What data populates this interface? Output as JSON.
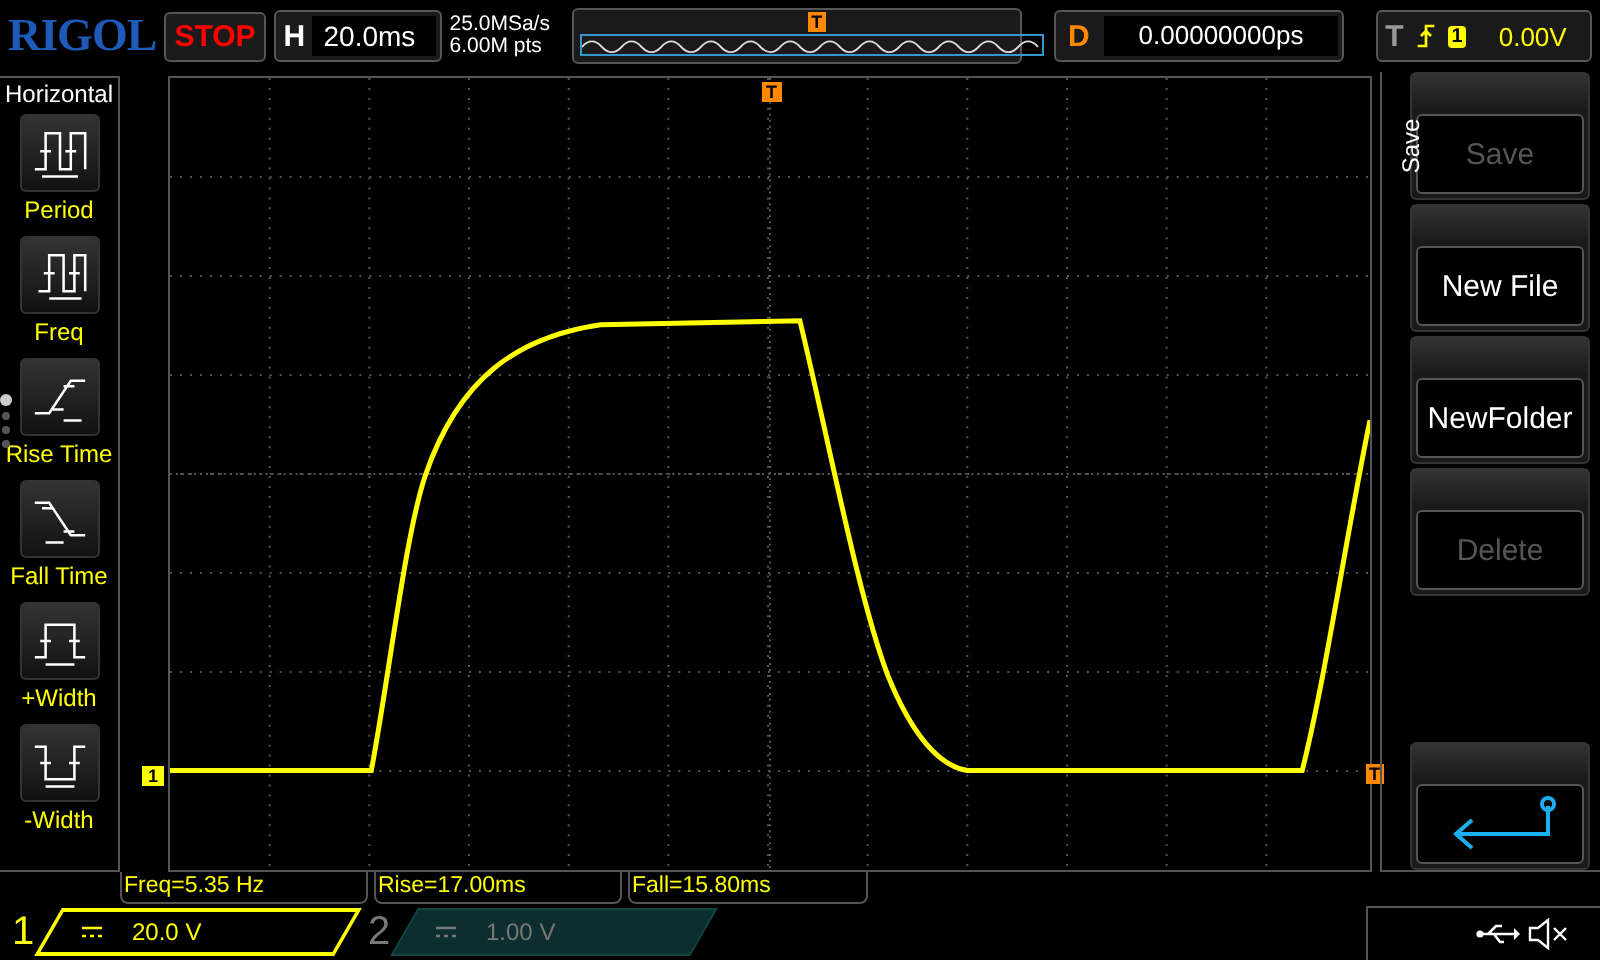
{
  "top_bar": {
    "logo": "RIGOL",
    "run_state": "STOP",
    "horizontal": {
      "label": "H",
      "value": "20.0ms"
    },
    "sample_rate": "25.0MSa/s",
    "memory_depth": "6.00M pts",
    "memory_trigger_marker": "T",
    "delay": {
      "label": "D",
      "value": "0.00000000ps"
    },
    "trigger": {
      "label": "T",
      "source": "1",
      "level": "0.00V"
    }
  },
  "left_panel": {
    "title": "Horizontal",
    "items": [
      {
        "kind": "period",
        "label": "Period"
      },
      {
        "kind": "freq",
        "label": "Freq"
      },
      {
        "kind": "rise",
        "label": "Rise Time"
      },
      {
        "kind": "fall",
        "label": "Fall Time"
      },
      {
        "kind": "pwidth",
        "label": "+Width"
      },
      {
        "kind": "nwidth",
        "label": "-Width"
      }
    ],
    "pages": [
      {
        "selected": true
      },
      {
        "selected": false
      },
      {
        "selected": false
      },
      {
        "selected": false
      }
    ]
  },
  "display": {
    "trigger_position_marker": "T",
    "channel_marker": "1",
    "trigger_level_marker": "T"
  },
  "menu": {
    "title": "Save",
    "buttons": [
      {
        "kind": "text",
        "label": "Save",
        "disabled": true
      },
      {
        "kind": "text",
        "label": "New File",
        "disabled": false
      },
      {
        "kind": "text",
        "label": "NewFolder",
        "disabled": false
      },
      {
        "kind": "text",
        "label": "Delete",
        "disabled": true
      },
      {
        "kind": "spacer"
      },
      {
        "kind": "back"
      }
    ]
  },
  "measurements": [
    "Freq=5.35 Hz",
    "Rise=17.00ms",
    "Fall=15.80ms"
  ],
  "channels": [
    {
      "number": "1",
      "scale": "20.0 V",
      "selected": true
    },
    {
      "number": "2",
      "scale": "1.00 V",
      "selected": false
    }
  ]
}
